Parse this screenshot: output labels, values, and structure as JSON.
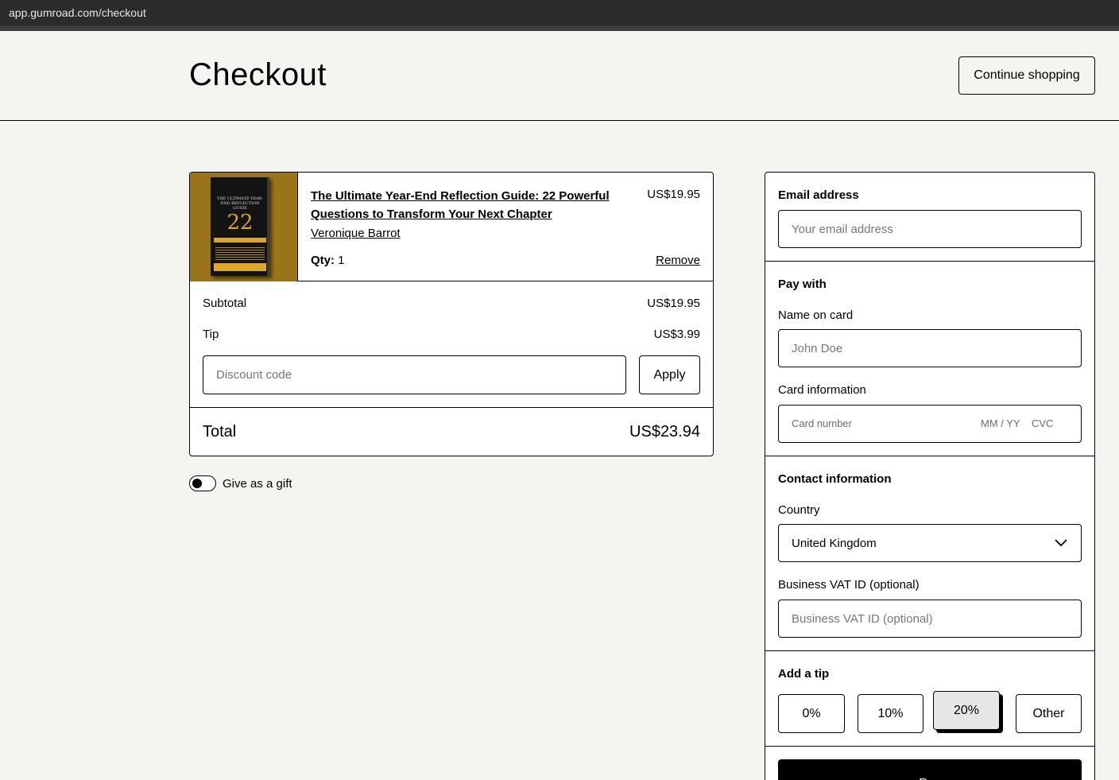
{
  "browser": {
    "url": "app.gumroad.com/checkout"
  },
  "header": {
    "title": "Checkout",
    "continue_label": "Continue shopping"
  },
  "cart": {
    "item": {
      "title": "The Ultimate Year-End Reflection Guide: 22 Powerful Questions to Transform Your Next Chapter",
      "author": "Veronique Barrot",
      "price": "US$19.95",
      "qty_label": "Qty:",
      "qty": "1",
      "remove_label": "Remove",
      "cover": {
        "title": "THE ULTIMATE YEAR-END REFLECTION GUIDE",
        "number": "22",
        "colors": {
          "background": "#9a7418",
          "book": "#131313",
          "accent": "#d9a531"
        }
      }
    },
    "subtotal_label": "Subtotal",
    "subtotal_value": "US$19.95",
    "tip_label": "Tip",
    "tip_value": "US$3.99",
    "discount_placeholder": "Discount code",
    "apply_label": "Apply",
    "total_label": "Total",
    "total_value": "US$23.94"
  },
  "gift": {
    "label": "Give as a gift",
    "enabled": false
  },
  "payment": {
    "email_title": "Email address",
    "email_placeholder": "Your email address",
    "pay_with_title": "Pay with",
    "name_label": "Name on card",
    "name_placeholder": "John Doe",
    "card_label": "Card information",
    "card_number_placeholder": "Card number",
    "card_exp_placeholder": "MM / YY",
    "card_cvc_placeholder": "CVC",
    "contact_title": "Contact information",
    "country_label": "Country",
    "country_value": "United Kingdom",
    "vat_label": "Business VAT ID (optional)",
    "vat_placeholder": "Business VAT ID (optional)",
    "tip_title": "Add a tip",
    "tip_options": [
      "0%",
      "10%",
      "20%",
      "Other"
    ],
    "tip_selected": "20%",
    "pay_label": "Pay"
  }
}
